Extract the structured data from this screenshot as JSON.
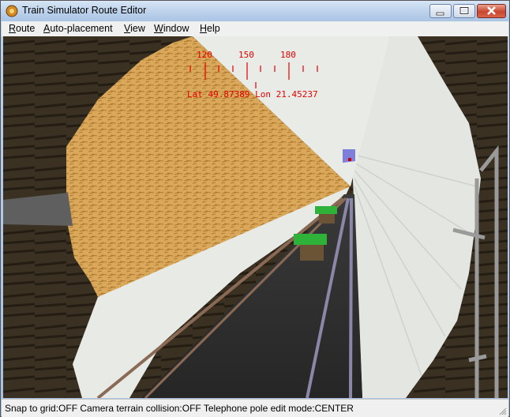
{
  "window": {
    "title": "Train Simulator Route Editor"
  },
  "menu": {
    "items": [
      {
        "label": "Route",
        "accel": "R",
        "rest": "oute"
      },
      {
        "label": "Auto-placement",
        "accel": "A",
        "rest": "uto-placement"
      },
      {
        "label": "View",
        "accel": "V",
        "rest": "iew"
      },
      {
        "label": "Window",
        "accel": "W",
        "rest": "indow"
      },
      {
        "label": "Help",
        "accel": "H",
        "rest": "elp"
      }
    ]
  },
  "hud": {
    "compass_labels": [
      "120",
      "150",
      "180"
    ],
    "position": "Lat 49.87389 Lon 21.45237",
    "color": "#e30000"
  },
  "status": {
    "text": "Snap to grid:OFF Camera terrain collision:OFF Telephone pole edit mode:CENTER"
  },
  "icons": {
    "app": "app-icon",
    "minimize": "minimize-icon",
    "maximize": "maximize-icon",
    "close": "close-icon",
    "grip": "resize-grip-icon"
  }
}
